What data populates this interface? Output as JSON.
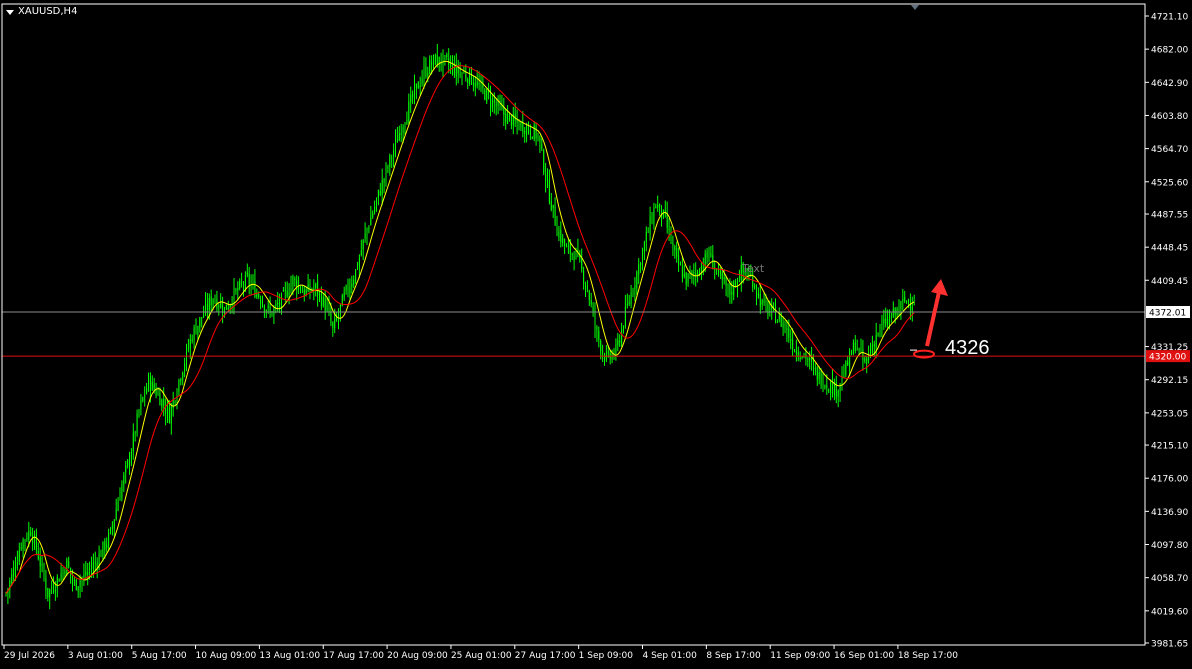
{
  "window": {
    "symbol": "XAUUSD,H4"
  },
  "chart_data": {
    "type": "candlestick",
    "symbol": "XAUUSD",
    "timeframe": "H4",
    "y_ticks": [
      "4721.10",
      "4682.00",
      "4642.90",
      "4603.80",
      "4564.70",
      "4525.60",
      "4487.55",
      "4448.45",
      "4409.45",
      "4331.25",
      "4292.15",
      "4253.05",
      "4215.10",
      "4176.00",
      "4136.90",
      "4097.80",
      "4058.70",
      "4019.60",
      "3981.65"
    ],
    "ylim": [
      3981.65,
      4721.1
    ],
    "x_ticks": [
      "29 Jul 2026",
      "3 Aug 01:00",
      "5 Aug 17:00",
      "10 Aug 09:00",
      "13 Aug 01:00",
      "17 Aug 17:00",
      "20 Aug 09:00",
      "25 Aug 01:00",
      "27 Aug 17:00",
      "1 Sep 09:00",
      "4 Sep 01:00",
      "8 Sep 17:00",
      "11 Sep 09:00",
      "16 Sep 01:00",
      "18 Sep 17:00"
    ],
    "price_lines": [
      {
        "name": "current",
        "value": 4372.01,
        "label": "4372.01",
        "color": "#8c8c8c"
      },
      {
        "name": "support",
        "value": 4320.0,
        "label": "4320.00",
        "color": "#e01010"
      }
    ],
    "close_path": [
      [
        0,
        4040
      ],
      [
        3,
        4060
      ],
      [
        8,
        4100
      ],
      [
        13,
        4115
      ],
      [
        17,
        4085
      ],
      [
        22,
        4040
      ],
      [
        28,
        4060
      ],
      [
        32,
        4075
      ],
      [
        36,
        4050
      ],
      [
        42,
        4062
      ],
      [
        48,
        4080
      ],
      [
        55,
        4110
      ],
      [
        60,
        4160
      ],
      [
        65,
        4200
      ],
      [
        70,
        4255
      ],
      [
        75,
        4290
      ],
      [
        80,
        4275
      ],
      [
        86,
        4250
      ],
      [
        92,
        4300
      ],
      [
        98,
        4345
      ],
      [
        104,
        4370
      ],
      [
        109,
        4390
      ],
      [
        115,
        4375
      ],
      [
        121,
        4395
      ],
      [
        127,
        4410
      ],
      [
        133,
        4392
      ],
      [
        139,
        4370
      ],
      [
        145,
        4385
      ],
      [
        151,
        4410
      ],
      [
        157,
        4395
      ],
      [
        163,
        4400
      ],
      [
        169,
        4375
      ],
      [
        172,
        4350
      ],
      [
        178,
        4390
      ],
      [
        184,
        4420
      ],
      [
        190,
        4470
      ],
      [
        196,
        4510
      ],
      [
        202,
        4550
      ],
      [
        208,
        4590
      ],
      [
        214,
        4625
      ],
      [
        220,
        4655
      ],
      [
        226,
        4670
      ],
      [
        232,
        4665
      ],
      [
        238,
        4655
      ],
      [
        244,
        4650
      ],
      [
        250,
        4635
      ],
      [
        256,
        4620
      ],
      [
        262,
        4605
      ],
      [
        268,
        4595
      ],
      [
        274,
        4590
      ],
      [
        280,
        4580
      ],
      [
        285,
        4520
      ],
      [
        290,
        4470
      ],
      [
        295,
        4445
      ],
      [
        300,
        4440
      ],
      [
        306,
        4400
      ],
      [
        311,
        4345
      ],
      [
        316,
        4315
      ],
      [
        321,
        4325
      ],
      [
        326,
        4370
      ],
      [
        331,
        4410
      ],
      [
        337,
        4460
      ],
      [
        342,
        4500
      ],
      [
        347,
        4480
      ],
      [
        353,
        4430
      ],
      [
        358,
        4410
      ],
      [
        364,
        4420
      ],
      [
        370,
        4440
      ],
      [
        376,
        4410
      ],
      [
        381,
        4395
      ],
      [
        387,
        4420
      ],
      [
        393,
        4410
      ],
      [
        398,
        4380
      ],
      [
        404,
        4370
      ],
      [
        410,
        4355
      ],
      [
        415,
        4330
      ],
      [
        421,
        4320
      ],
      [
        426,
        4300
      ],
      [
        431,
        4290
      ],
      [
        437,
        4280
      ],
      [
        442,
        4305
      ],
      [
        447,
        4335
      ],
      [
        452,
        4310
      ],
      [
        458,
        4345
      ],
      [
        463,
        4360
      ],
      [
        468,
        4370
      ],
      [
        473,
        4385
      ],
      [
        478,
        4385
      ]
    ],
    "indicators": [
      {
        "type": "moving-average",
        "color": "#ffff00"
      },
      {
        "type": "moving-average",
        "color": "#ff0000"
      }
    ],
    "annotations": [
      {
        "type": "text",
        "text": "4326"
      },
      {
        "type": "arrow",
        "direction": "up",
        "color": "#ff3030"
      },
      {
        "type": "ellipse",
        "color": "#ff2020"
      },
      {
        "type": "label",
        "text": "Text"
      }
    ],
    "colors": {
      "background": "#000000",
      "candles": "#00ff00",
      "axis": "#ffffff"
    }
  }
}
